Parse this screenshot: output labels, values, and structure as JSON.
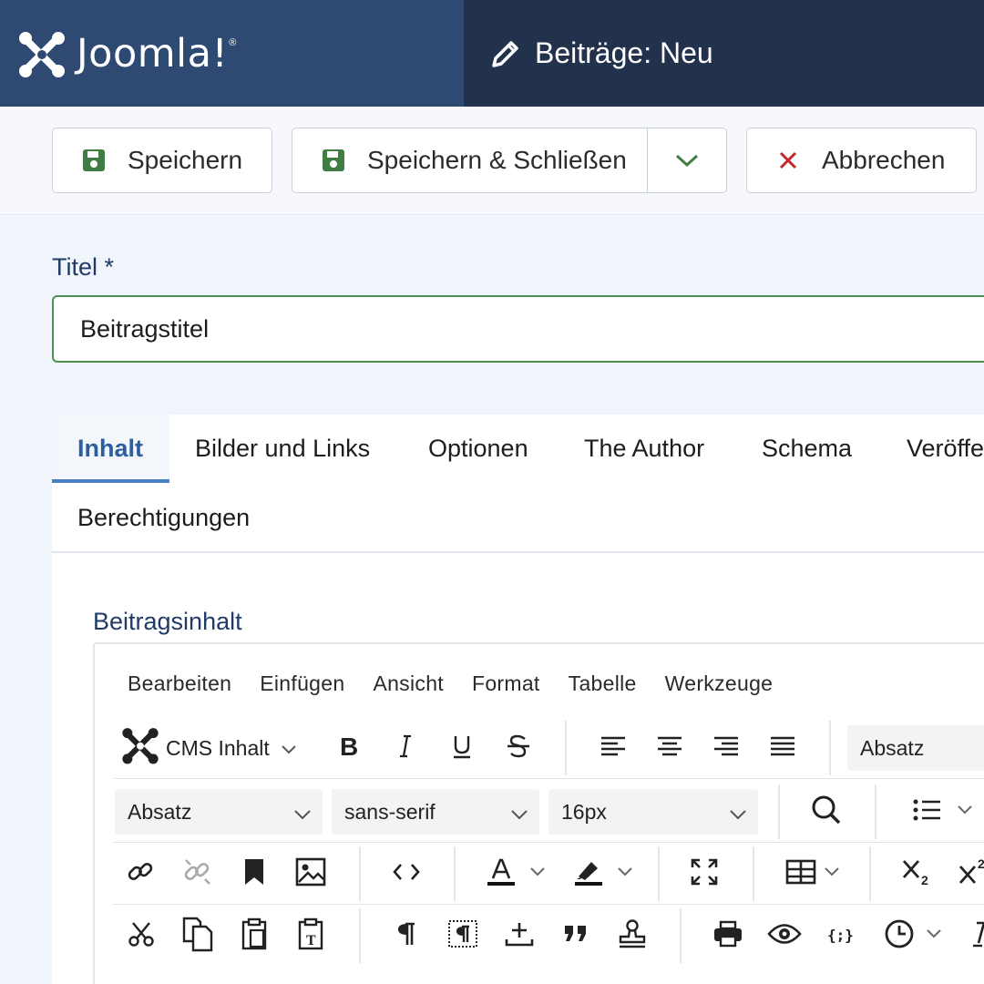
{
  "header": {
    "brand_name": "Joomla!",
    "page_title": "Beiträge: Neu"
  },
  "toolbar": {
    "save_label": "Speichern",
    "save_close_label": "Speichern & Schließen",
    "cancel_label": "Abbrechen"
  },
  "title_field": {
    "label": "Titel *",
    "value": "Beitragstitel"
  },
  "tabs": [
    {
      "label": "Inhalt",
      "active": true
    },
    {
      "label": "Bilder und Links"
    },
    {
      "label": "Optionen"
    },
    {
      "label": "The Author"
    },
    {
      "label": "Schema"
    },
    {
      "label": "Veröffe"
    },
    {
      "label": "Berechtigungen"
    }
  ],
  "editor": {
    "label": "Beitragsinhalt",
    "menu": [
      "Bearbeiten",
      "Einfügen",
      "Ansicht",
      "Format",
      "Tabelle",
      "Werkzeuge"
    ],
    "cms_content": "CMS Inhalt",
    "block_format_row1": "Absatz",
    "block_format": "Absatz",
    "font_family": "sans-serif",
    "font_size": "16px"
  },
  "colors": {
    "header_brand_bg": "#2e4a72",
    "header_title_bg": "#22324d",
    "save_icon": "#3f7d45",
    "cancel_icon": "#c62828",
    "active_tab": "#2b5fa0",
    "title_border": "#4f8f54"
  },
  "icons": [
    "joomla-logo",
    "pencil-icon",
    "save-icon",
    "chevron-down-icon",
    "close-icon",
    "bold-icon",
    "italic-icon",
    "underline-icon",
    "strikethrough-icon",
    "align-left-icon",
    "align-center-icon",
    "align-right-icon",
    "justify-icon",
    "search-icon",
    "bullet-list-icon",
    "link-icon",
    "unlink-icon",
    "bookmark-icon",
    "image-icon",
    "code-icon",
    "text-color-icon",
    "highlight-icon",
    "fullscreen-icon",
    "table-icon",
    "subscript-icon",
    "superscript-icon",
    "cut-icon",
    "copy-icon",
    "paste-icon",
    "paste-text-icon",
    "pilcrow-icon",
    "show-blocks-icon",
    "insert-icon",
    "blockquote-icon",
    "stamp-icon",
    "print-icon",
    "preview-icon",
    "template-icon",
    "clock-icon",
    "clear-format-icon"
  ]
}
